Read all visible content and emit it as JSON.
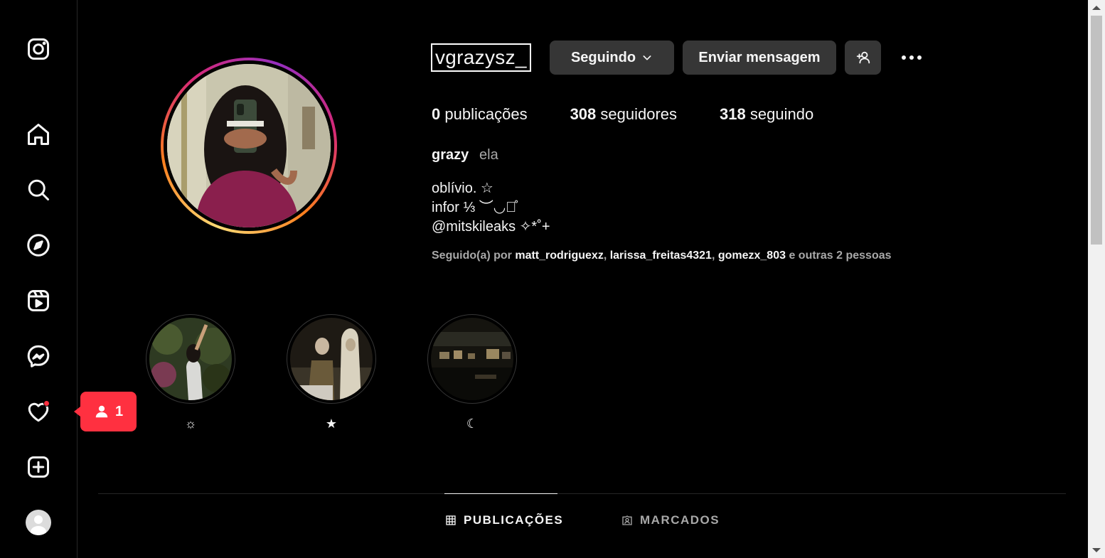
{
  "sidebar": {
    "items": [
      {
        "name": "instagram-logo-icon"
      },
      {
        "name": "home-icon"
      },
      {
        "name": "search-icon"
      },
      {
        "name": "explore-icon"
      },
      {
        "name": "reels-icon"
      },
      {
        "name": "messenger-icon"
      },
      {
        "name": "heart-icon"
      },
      {
        "name": "create-icon"
      },
      {
        "name": "profile-avatar"
      }
    ],
    "notification_popup": {
      "icon": "person-icon",
      "count": "1"
    }
  },
  "profile": {
    "username": "vgrazysz_",
    "buttons": {
      "following": "Seguindo",
      "message": "Enviar mensagem",
      "suggest_icon": "person-add-icon",
      "more_icon": "more-options-icon"
    },
    "stats": {
      "posts_count": "0",
      "posts_label": "publicações",
      "followers_count": "308",
      "followers_label": "seguidores",
      "following_count": "318",
      "following_label": "seguindo"
    },
    "full_name": "grazy",
    "pronoun": "ela",
    "bio": "oblívio. ☆\ninfor ⅓ ︶◡꒱̊\n@mitskileaks ✧*˚+",
    "followed_by": {
      "prefix": "Seguido(a) por",
      "names": [
        "matt_rodriguexz",
        "larissa_freitas4321",
        "gomezx_803"
      ],
      "suffix": "e outras 2 pessoas"
    }
  },
  "highlights": [
    {
      "label": "☼"
    },
    {
      "label": "★"
    },
    {
      "label": "☾"
    }
  ],
  "tabs": [
    {
      "label": "PUBLICAÇÕES",
      "icon": "grid-icon",
      "active": true
    },
    {
      "label": "MARCADOS",
      "icon": "tagged-icon",
      "active": false
    }
  ],
  "colors": {
    "background": "#000000",
    "button": "#363636",
    "notification": "#ff3040",
    "muted_text": "#a8a8a8"
  }
}
